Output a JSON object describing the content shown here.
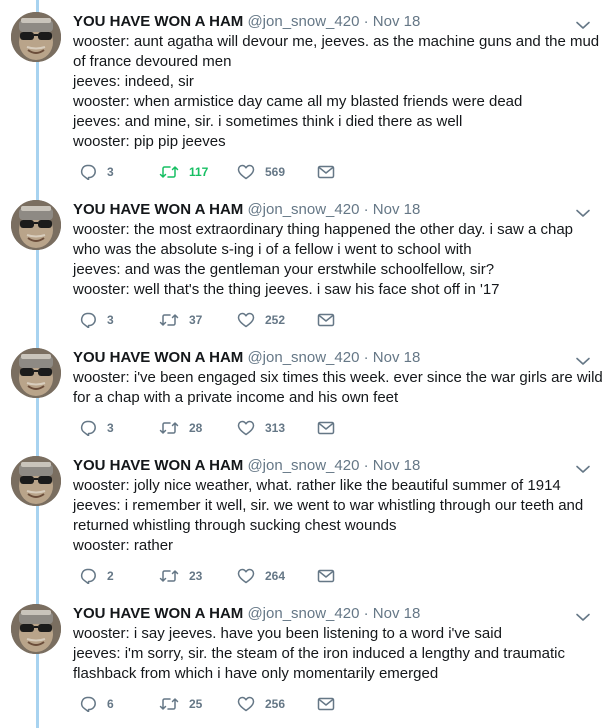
{
  "tweets": [
    {
      "name": "YOU HAVE WON A HAM",
      "handle": "@jon_snow_420",
      "separator": "·",
      "date": "Nov 18",
      "lines": [
        "wooster: aunt agatha will devour me, jeeves. as the machine guns and the mud",
        "of france devoured men",
        "jeeves: indeed, sir",
        "wooster: when armistice day came all my blasted friends were dead",
        "jeeves: and mine, sir. i sometimes think i died there as well",
        "wooster: pip pip jeeves"
      ],
      "replies": "3",
      "retweets": "117",
      "likes": "569",
      "retweeted": true
    },
    {
      "name": "YOU HAVE WON A HAM",
      "handle": "@jon_snow_420",
      "separator": "·",
      "date": "Nov 18",
      "lines": [
        "wooster: the most extraordinary thing happened the other day. i saw a chap",
        "who was the absolute s-ing i of a fellow i went to school with",
        "jeeves: and was the gentleman your erstwhile schoolfellow, sir?",
        "wooster: well that's the thing jeeves. i saw his face shot off in '17"
      ],
      "replies": "3",
      "retweets": "37",
      "likes": "252",
      "retweeted": false
    },
    {
      "name": "YOU HAVE WON A HAM",
      "handle": "@jon_snow_420",
      "separator": "·",
      "date": "Nov 18",
      "lines": [
        "wooster: i've been engaged six times this week. ever since the war girls are wild",
        "for a chap with a private income and his own feet"
      ],
      "replies": "3",
      "retweets": "28",
      "likes": "313",
      "retweeted": false
    },
    {
      "name": "YOU HAVE WON A HAM",
      "handle": "@jon_snow_420",
      "separator": "·",
      "date": "Nov 18",
      "lines": [
        "wooster: jolly nice weather, what. rather like the beautiful summer of 1914",
        "jeeves: i remember it well, sir. we went to war whistling through our teeth and",
        "returned whistling through sucking chest wounds",
        "wooster: rather"
      ],
      "replies": "2",
      "retweets": "23",
      "likes": "264",
      "retweeted": false
    },
    {
      "name": "YOU HAVE WON A HAM",
      "handle": "@jon_snow_420",
      "separator": "·",
      "date": "Nov 18",
      "lines": [
        "wooster: i say jeeves. have you been listening to a word i've said",
        "jeeves: i'm sorry, sir. the steam of the iron induced a lengthy and traumatic",
        "flashback from which i have only momentarily emerged"
      ],
      "replies": "6",
      "retweets": "25",
      "likes": "256",
      "retweeted": false
    }
  ],
  "colors": {
    "thread_line": "#a8d3f0",
    "action_gray": "#657786",
    "retweet_active": "#17bf63",
    "text": "#14171a"
  },
  "icons": {
    "reply": "reply-icon",
    "retweet": "retweet-icon",
    "like": "heart-icon",
    "message": "envelope-icon",
    "menu": "chevron-down-icon"
  }
}
